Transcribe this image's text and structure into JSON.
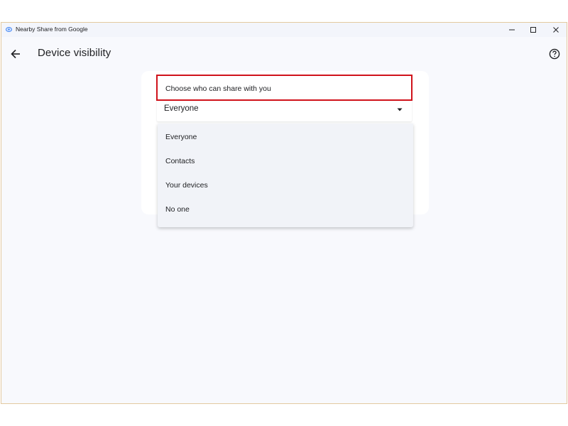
{
  "window": {
    "title": "Nearby Share from Google",
    "controls": [
      "minimize",
      "maximize",
      "close"
    ]
  },
  "header": {
    "back_icon": "arrow-left-icon",
    "title": "Device visibility",
    "help_icon": "help-circle-icon"
  },
  "visibility": {
    "label": "Choose who can share with you",
    "selected": "Everyone",
    "caret_icon": "caret-down-icon",
    "options": [
      "Everyone",
      "Contacts",
      "Your devices",
      "No one"
    ]
  },
  "colors": {
    "highlight": "#d0121b",
    "background": "#f8f9fd",
    "menu_background": "#f1f3f8"
  }
}
